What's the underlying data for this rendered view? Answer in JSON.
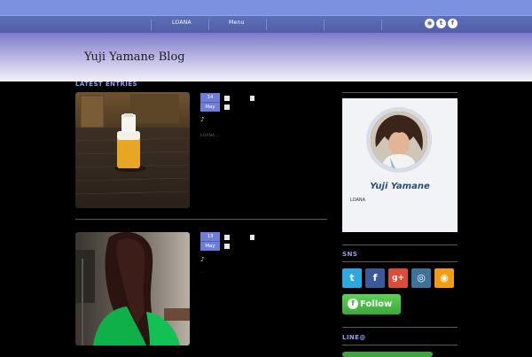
{
  "nav": {
    "items": [
      {
        "label": "LOANA"
      },
      {
        "label": "Menu"
      }
    ],
    "social": [
      {
        "icon": "rss-icon",
        "glyph": "◉"
      },
      {
        "icon": "twitter-icon",
        "glyph": "t"
      },
      {
        "icon": "facebook-icon",
        "glyph": "f"
      }
    ]
  },
  "header": {
    "blog_title": "Yuji Yamane Blog"
  },
  "main": {
    "section_title": "LATEST ENTRIES",
    "posts": [
      {
        "day": "14",
        "month": "May",
        "note": "♪",
        "excerpt": "LOANA..."
      },
      {
        "day": "13",
        "month": "May",
        "note": "♪",
        "excerpt": "..."
      }
    ]
  },
  "sidebar": {
    "profile": {
      "name": "Yuji Yamane",
      "description": "LOANA"
    },
    "sns_title": "SNS",
    "sns_buttons": [
      {
        "icon": "twitter-icon",
        "glyph": "t",
        "color": "#2aa9e0"
      },
      {
        "icon": "facebook-icon",
        "glyph": "f",
        "color": "#3b5998"
      },
      {
        "icon": "google-plus-icon",
        "glyph": "g+",
        "color": "#dd4b39"
      },
      {
        "icon": "instagram-icon",
        "glyph": "◎",
        "color": "#3f729b"
      },
      {
        "icon": "rss-icon",
        "glyph": "◉",
        "color": "#f39c12"
      }
    ],
    "follow_label": "Follow",
    "line_title": "LINE@"
  },
  "colors": {
    "accent": "#6c7ed8",
    "section_title": "#8ea1ee",
    "nav_bg": "#5d6fb8",
    "follow_green": "#3aa837"
  }
}
